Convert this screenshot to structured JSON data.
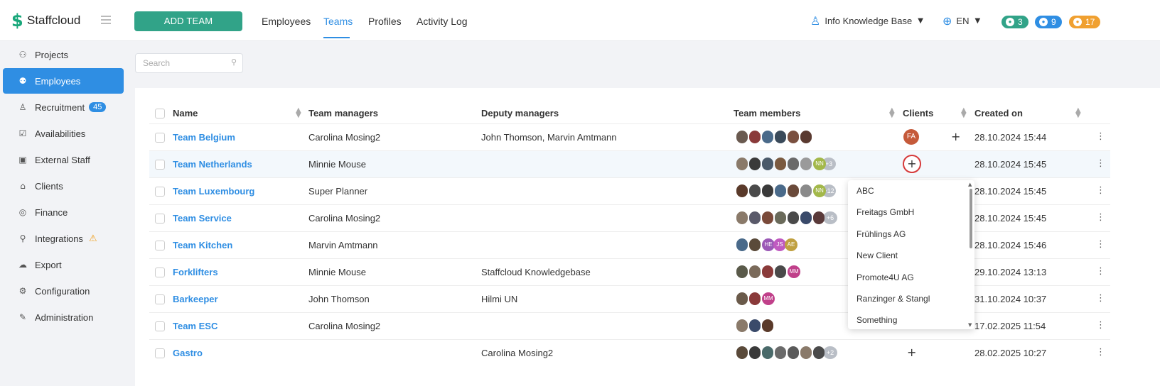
{
  "brand": {
    "name": "Staffcloud",
    "logo_icon": "staffcloud-logo",
    "color": "#18a77a"
  },
  "sidebar": {
    "items": [
      {
        "label": "Projects",
        "icon": "sitemap-icon",
        "glyph": "⚇"
      },
      {
        "label": "Employees",
        "icon": "users-icon",
        "glyph": "⚉",
        "active": true
      },
      {
        "label": "Recruitment",
        "icon": "person-icon",
        "glyph": "♙",
        "badge": "45"
      },
      {
        "label": "Availabilities",
        "icon": "calendar-check-icon",
        "glyph": "☑"
      },
      {
        "label": "External Staff",
        "icon": "id-card-icon",
        "glyph": "▣"
      },
      {
        "label": "Clients",
        "icon": "bank-icon",
        "glyph": "⌂"
      },
      {
        "label": "Finance",
        "icon": "coin-icon",
        "glyph": "◎"
      },
      {
        "label": "Integrations",
        "icon": "plug-icon",
        "glyph": "⚲",
        "warning": "⚠"
      },
      {
        "label": "Export",
        "icon": "cloud-upload-icon",
        "glyph": "☁"
      },
      {
        "label": "Configuration",
        "icon": "gear-icon",
        "glyph": "⚙"
      },
      {
        "label": "Administration",
        "icon": "wrench-icon",
        "glyph": "✎"
      }
    ]
  },
  "toolbar": {
    "add_team_label": "ADD TEAM",
    "tabs": [
      {
        "label": "Employees"
      },
      {
        "label": "Teams",
        "active": true
      },
      {
        "label": "Profiles"
      },
      {
        "label": "Activity Log"
      }
    ],
    "knowledge_base": "Info Knowledge Base",
    "language": "EN",
    "badges": [
      {
        "icon": "chat-icon",
        "count": "3",
        "color": "#31a388"
      },
      {
        "icon": "bell-icon",
        "count": "9",
        "color": "#2f8ee3"
      },
      {
        "icon": "clock-icon",
        "count": "17",
        "color": "#f0a030"
      }
    ]
  },
  "search": {
    "placeholder": "Search"
  },
  "table": {
    "columns": [
      "Name",
      "Team managers",
      "Deputy managers",
      "Team members",
      "Clients",
      "Created on"
    ],
    "rows": [
      {
        "name": "Team Belgium",
        "managers": "Carolina Mosing2",
        "deputies": "John Thomson, Marvin Amtmann",
        "members": [
          "#6a5a50",
          "#8a3a3a",
          "#4a6a8a",
          "#3a4a5a",
          "#7a5040",
          "#5a3a30"
        ],
        "initials": [],
        "more": "",
        "client": "FA",
        "created": "28.10.2024 15:44"
      },
      {
        "name": "Team Netherlands",
        "managers": "Minnie Mouse",
        "deputies": "",
        "members": [
          "#8a7a6a",
          "#3a3a3a",
          "#4a5a6a",
          "#7a5a40",
          "#6a6a6a",
          "#9a9a9a"
        ],
        "initials": [
          {
            "t": "NN",
            "c": "#a3b84a"
          }
        ],
        "more": "+3",
        "client": "",
        "created": "28.10.2024 15:45"
      },
      {
        "name": "Team Luxembourg",
        "managers": "Super Planner",
        "deputies": "",
        "members": [
          "#5a3a2a",
          "#4a4a4a",
          "#3a3a3a",
          "#4a6a8a",
          "#6a4a3a",
          "#8a8a8a"
        ],
        "initials": [
          {
            "t": "NN",
            "c": "#a3b84a"
          }
        ],
        "more": "+12",
        "client": "",
        "created": "28.10.2024 15:45"
      },
      {
        "name": "Team Service",
        "managers": "Carolina Mosing2",
        "deputies": "",
        "members": [
          "#8a7a6a",
          "#5a5a6a",
          "#7a4a3a",
          "#6a6a5a",
          "#4a4a4a",
          "#3a4a6a",
          "#5a3a3a"
        ],
        "initials": [],
        "more": "+6",
        "client": "",
        "created": "28.10.2024 15:45"
      },
      {
        "name": "Team Kitchen",
        "managers": "Marvin Amtmann",
        "deputies": "",
        "members": [
          "#4a6a8a",
          "#5a4a3a"
        ],
        "initials": [
          {
            "t": "HE",
            "c": "#9b59b6"
          },
          {
            "t": "JS",
            "c": "#c05ac0"
          },
          {
            "t": "AE",
            "c": "#c0a040"
          }
        ],
        "more": "",
        "client": "",
        "created": "28.10.2024 15:46"
      },
      {
        "name": "Forklifters",
        "managers": "Minnie Mouse",
        "deputies": "Staffcloud Knowledgebase",
        "members": [
          "#5a5a4a",
          "#7a6a5a",
          "#8a3a3a",
          "#4a4a4a"
        ],
        "initials": [
          {
            "t": "MM",
            "c": "#c0408a"
          }
        ],
        "more": "",
        "client": "",
        "created": "29.10.2024 13:13"
      },
      {
        "name": "Barkeeper",
        "managers": "John Thomson",
        "deputies": "Hilmi UN",
        "members": [
          "#6a5a4a",
          "#8a3a3a"
        ],
        "initials": [
          {
            "t": "MM",
            "c": "#c0408a"
          }
        ],
        "more": "",
        "client": "",
        "created": "31.10.2024 10:37"
      },
      {
        "name": "Team ESC",
        "managers": "Carolina Mosing2",
        "deputies": "",
        "members": [
          "#8a7a6a",
          "#3a4a6a",
          "#5a3a2a"
        ],
        "initials": [],
        "more": "",
        "client": "",
        "created": "17.02.2025 11:54"
      },
      {
        "name": "Gastro",
        "managers": "",
        "deputies": "Carolina Mosing2",
        "members": [
          "#5a4a3a",
          "#3a3a3a",
          "#4a6a6a",
          "#6a6a6a",
          "#5a5a5a",
          "#8a7a6a",
          "#4a4a4a"
        ],
        "initials": [],
        "more": "+2",
        "client": "",
        "created": "28.02.2025 10:27"
      }
    ]
  },
  "client_dropdown": {
    "options": [
      "ABC",
      "Freitags GmbH",
      "Frühlings AG",
      "New Client",
      "Promote4U AG",
      "Ranzinger & Stangl",
      "Something"
    ]
  }
}
